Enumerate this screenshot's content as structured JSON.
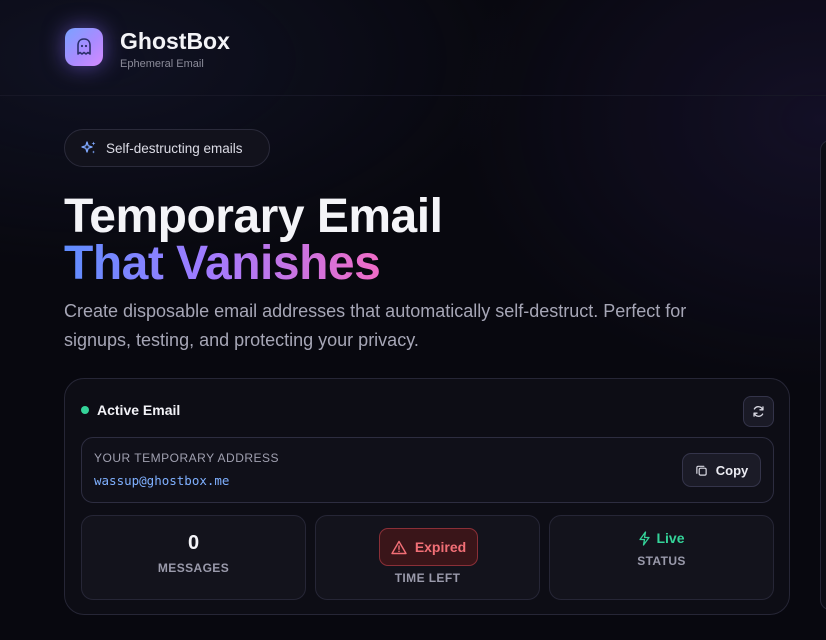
{
  "brand": {
    "name": "GhostBox",
    "tagline": "Ephemeral Email",
    "logo_icon": "ghost-icon"
  },
  "badge": {
    "icon": "sparkles-icon",
    "label": "Self-destructing emails"
  },
  "hero": {
    "title_line1": "Temporary Email",
    "title_line2": "That Vanishes",
    "description": "Create disposable email addresses that automatically self-destruct. Perfect for signups, testing, and protecting your privacy."
  },
  "email_card": {
    "status_label": "Active Email",
    "refresh_icon": "refresh-icon",
    "address_label": "YOUR TEMPORARY ADDRESS",
    "address": "wassup@ghostbox.me",
    "copy_label": "Copy",
    "copy_icon": "copy-icon"
  },
  "stats": {
    "messages": {
      "value": "0",
      "label": "MESSAGES"
    },
    "time_left": {
      "badge": "Expired",
      "label": "TIME LEFT",
      "icon": "alert-triangle-icon"
    },
    "status": {
      "value": "Live",
      "label": "STATUS",
      "icon": "zap-icon"
    }
  },
  "colors": {
    "background": "#08080f",
    "accent_blue": "#5f8dff",
    "accent_purple": "#a07bff",
    "accent_pink": "#f06cc6",
    "live_green": "#34d399",
    "expired_red": "#f26f76",
    "address_blue": "#7fb0ff"
  }
}
